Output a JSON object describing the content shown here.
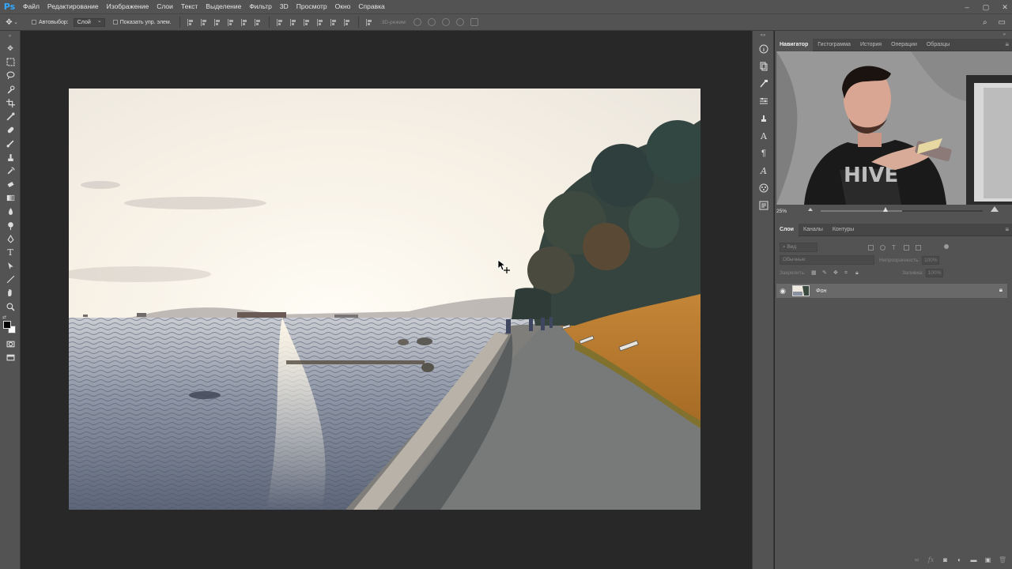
{
  "app": {
    "logo": "Ps"
  },
  "menu": {
    "items": [
      "Файл",
      "Редактирование",
      "Изображение",
      "Слои",
      "Текст",
      "Выделение",
      "Фильтр",
      "3D",
      "Просмотр",
      "Окно",
      "Справка"
    ]
  },
  "options": {
    "autoselect_label": "Автовыбор:",
    "autoselect_target": "Слой",
    "show_transform_label": "Показать упр. элем.",
    "mode_3d_label": "3D-режим:"
  },
  "navigator": {
    "tabs": [
      "Навигатор",
      "Гистограмма",
      "История",
      "Операции",
      "Образцы"
    ],
    "active_tab": "Навигатор",
    "zoom": "25%",
    "zoom_slider_fraction": 0.5
  },
  "layers": {
    "tabs": [
      "Слои",
      "Каналы",
      "Контуры"
    ],
    "active_tab": "Слои",
    "filter_placeholder": "Вид",
    "blend_mode": "Обычные",
    "opacity_label": "Непрозрачность:",
    "opacity_value": "100%",
    "lock_label": "Закрепить:",
    "fill_label": "Заливка:",
    "fill_value": "100%",
    "items": [
      {
        "name": "Фон",
        "visible": true,
        "locked": true
      }
    ]
  },
  "colors": {
    "foreground": "#000000",
    "background": "#ffffff",
    "accent": "#31a8ff"
  }
}
